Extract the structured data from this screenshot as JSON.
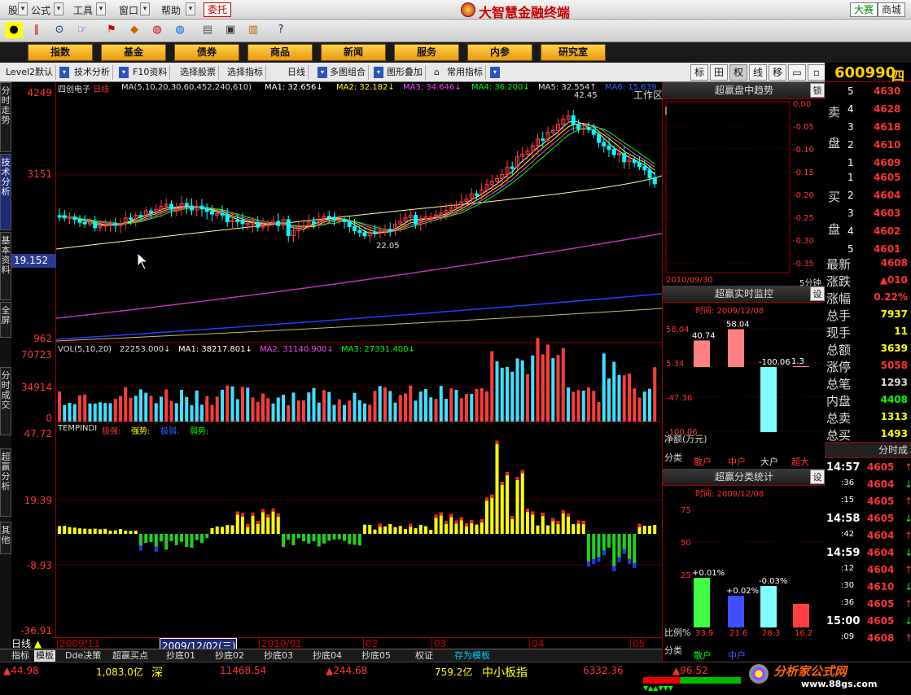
{
  "menu": {
    "items": [
      "股票",
      "公式",
      "工具",
      "窗口",
      "帮助"
    ],
    "wt": "委托",
    "title": "大智慧金融终端",
    "race": "大赛",
    "mall": "商城"
  },
  "nav": {
    "buttons": [
      "指数",
      "基金",
      "债券",
      "商品",
      "新闻",
      "服务",
      "内参",
      "研究室"
    ],
    "workarea": "工作区"
  },
  "subbar": {
    "items": [
      "Level2默认",
      "技术分析",
      "F10资料",
      "选择股票",
      "选择指标",
      "日线",
      "多图组合",
      "图形叠加",
      "常用指标"
    ],
    "right_tabs": [
      "标",
      "田",
      "权",
      "线",
      "移"
    ]
  },
  "sidetabs": [
    "分时走势",
    "技术分析",
    "基本资料",
    "全屏",
    "分时成交",
    "超赢分析",
    "其他"
  ],
  "stock": {
    "code": "600990",
    "name": "四创电子",
    "period": "日线",
    "short": "四"
  },
  "yaxis": {
    "top": "4249",
    "mid": "3151",
    "cur": "19.152",
    "low": "962",
    "vol_max": "70723",
    "vol_mid": "34914",
    "vol_zero": "0",
    "ind_max": "47.72",
    "ind_mid": "19.39",
    "ind_low": "-8.93",
    "ind_min": "-36.91"
  },
  "ma": {
    "formula": "MA(5,10,20,30,60,452,240,610)",
    "ma1": "MA1: 32.656↓",
    "ma2": "MA2: 32.182↓",
    "ma3": "MA3: 34.646↓",
    "ma4": "MA4: 36.200↓",
    "ma5": "MA5: 32.554↑",
    "ma6": "MA6: 15.639",
    "hi": "42.45",
    "lo": "22.05"
  },
  "vol": {
    "formula": "VOL(5,10,20)",
    "v": "22253.000↓",
    "ma1": "MA1: 38217.801↓",
    "ma2": "MA2: 31140.900↓",
    "ma3": "MA3: 27331.400↓"
  },
  "ind": {
    "name": "TEMPINDI",
    "l1": "极强:",
    "l2": "强势:",
    "l3": "极弱:",
    "l4": "弱势:"
  },
  "dates": [
    "2009/11",
    "2009/12/02(三)",
    "2010/01",
    "02",
    "03",
    "04",
    "05"
  ],
  "period_btn": "日线",
  "btabs": [
    "指标",
    "模板",
    "Dde决策",
    "超赢买点",
    "抄底01",
    "抄底02",
    "抄底03",
    "抄底04",
    "抄底05",
    "权证",
    "存为模板"
  ],
  "status": {
    "a": "44.98",
    "b": "1,083.0亿",
    "c": "深",
    "d": "11468.54",
    "e": "244.68",
    "f": "759.2亿",
    "g": "中小板指",
    "h": "6332.36",
    "i": "96.52",
    "brand": "分析家公式网",
    "url": "www.88gs.com"
  },
  "rpanel": {
    "trend": {
      "title": "超赢盘中趋势",
      "btn": "锁",
      "date": "2010/09/30",
      "unit": "5分钟",
      "ticks": [
        "0.00",
        "-0.05",
        "-0.10",
        "-0.15",
        "-0.20",
        "-0.25",
        "-0.30",
        "-0.35"
      ]
    },
    "monitor": {
      "title": "超赢实时监控",
      "btn": "设",
      "time": "时间: 2009/12/08",
      "ticks": [
        "58.04",
        "5.34",
        "-47.36",
        "-100.06"
      ],
      "net": "净额(万元)",
      "cat": "分类",
      "cats": [
        "散户",
        "中户",
        "大户",
        "超大"
      ]
    },
    "stats": {
      "title": "超赢分类统计",
      "btn": "设",
      "time": "时间: 2009/12/08",
      "ticks": [
        "75",
        "50",
        "25"
      ],
      "ratio": "比例%",
      "cat": "分类",
      "cats": [
        "散户",
        "中户"
      ]
    }
  },
  "monitor_bars": {
    "values": [
      40.74,
      58.04,
      -100.06,
      1.3
    ],
    "labels": [
      "40.74",
      "58.04",
      "-100.06",
      "1.3"
    ]
  },
  "stats_bars": {
    "values": [
      33.9,
      21.6,
      28.3,
      16.2
    ],
    "labels": [
      "+0.01%",
      "+0.02%",
      "-0.03%",
      ""
    ],
    "bottom": [
      "33.9",
      "21.6",
      "28.3",
      "16.2"
    ]
  },
  "quote": {
    "sell": [
      {
        "n": "5",
        "p": "4630"
      },
      {
        "n": "4",
        "p": "4628"
      },
      {
        "n": "3",
        "p": "4618"
      },
      {
        "n": "2",
        "p": "4610"
      },
      {
        "n": "1",
        "p": "4609"
      }
    ],
    "buy": [
      {
        "n": "1",
        "p": "4605"
      },
      {
        "n": "2",
        "p": "4604"
      },
      {
        "n": "3",
        "p": "4603"
      },
      {
        "n": "4",
        "p": "4602"
      },
      {
        "n": "5",
        "p": "4601"
      }
    ],
    "sell_lbl": "卖盘",
    "buy_lbl": "买盘",
    "info": [
      {
        "k": "最新",
        "v": "4608"
      },
      {
        "k": "涨跌",
        "v": "▲010"
      },
      {
        "k": "涨幅",
        "v": "0.22%"
      },
      {
        "k": "总手",
        "v": "7937"
      },
      {
        "k": "现手",
        "v": "11"
      },
      {
        "k": "总额",
        "v": "3639"
      },
      {
        "k": "涨停",
        "v": "5058"
      },
      {
        "k": "总笔",
        "v": "1293"
      },
      {
        "k": "内盘",
        "v": "4408"
      },
      {
        "k": "总卖",
        "v": "1313"
      },
      {
        "k": "总买",
        "v": "1493"
      }
    ],
    "ticks_title": "分时成",
    "ticks": [
      {
        "t": "14:57",
        "p": "4605"
      },
      {
        "t": ":36",
        "p": "4604"
      },
      {
        "t": ":15",
        "p": "4605"
      },
      {
        "t": "14:58",
        "p": "4605"
      },
      {
        "t": ":42",
        "p": "4604"
      },
      {
        "t": "14:59",
        "p": "4604"
      },
      {
        "t": ":12",
        "p": "4604"
      },
      {
        "t": ":30",
        "p": "4610"
      },
      {
        "t": ":36",
        "p": "4605"
      },
      {
        "t": "15:00",
        "p": "4605"
      },
      {
        "t": ":09",
        "p": "4608"
      }
    ]
  },
  "colors": {
    "up": "#ff3c3c",
    "down": "#00ffff",
    "ma1": "#ffffff",
    "ma2": "#ffff00",
    "ma3": "#ff40ff",
    "ma4": "#00ff00",
    "yellow": "#ffff00",
    "red": "#ff2020"
  }
}
